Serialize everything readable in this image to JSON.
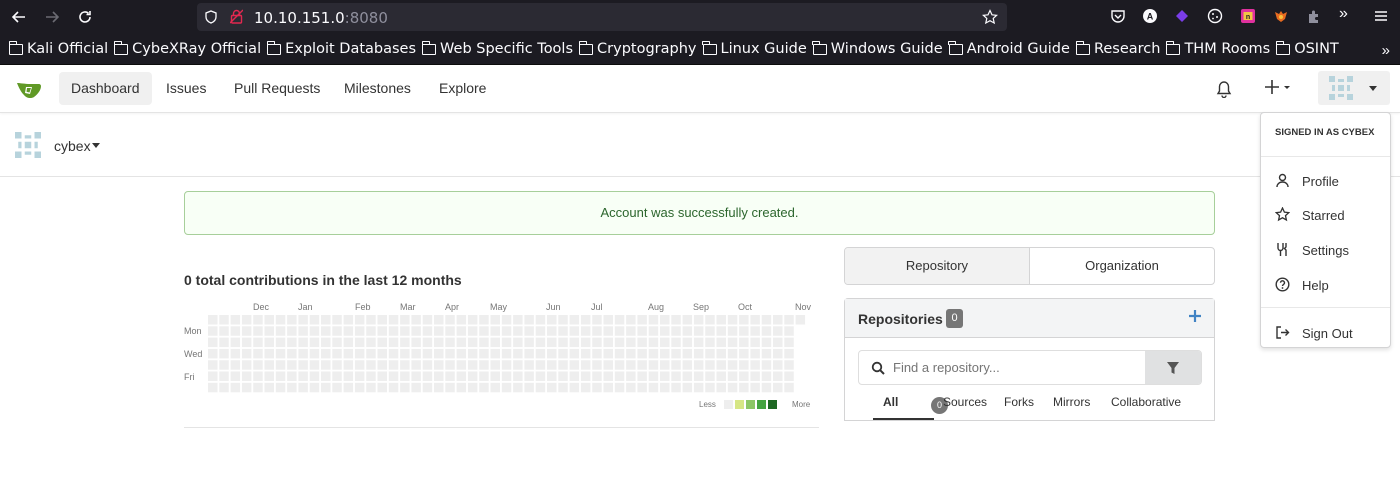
{
  "browser": {
    "url_host": "10.10.151.0",
    "url_port": ":8080",
    "bookmarks": [
      "Kali Official",
      "CybeXRay Official",
      "Exploit Databases",
      "Web Specific Tools",
      "Cryptography",
      "Linux Guide",
      "Windows Guide",
      "Android Guide",
      "Research",
      "THM Rooms",
      "OSINT"
    ]
  },
  "header": {
    "nav": [
      "Dashboard",
      "Issues",
      "Pull Requests",
      "Milestones",
      "Explore"
    ]
  },
  "context": {
    "username": "cybex"
  },
  "flash": {
    "message": "Account was successfully created."
  },
  "heatmap": {
    "title": "0 total contributions in the last 12 months",
    "months": [
      "Dec",
      "Jan",
      "Feb",
      "Mar",
      "Apr",
      "May",
      "Jun",
      "Jul",
      "Aug",
      "Sep",
      "Oct",
      "Nov"
    ],
    "days": [
      "Mon",
      "Wed",
      "Fri"
    ],
    "legend_less": "Less",
    "legend_more": "More",
    "empty_color": "#eeeeee",
    "legend_colors": [
      "#eeeeee",
      "#d6e685",
      "#8cc665",
      "#44a340",
      "#1e6823"
    ]
  },
  "panel": {
    "tabs": [
      "Repository",
      "Organization"
    ],
    "repos_title": "Repositories",
    "repos_count": "0",
    "search_placeholder": "Find a repository...",
    "filter_tabs": [
      "All",
      "Sources",
      "Forks",
      "Mirrors",
      "Collaborative"
    ],
    "all_count": "0"
  },
  "dropdown": {
    "signed_in_prefix": "SIGNED IN AS",
    "signed_in_user": "CYBEX",
    "items": [
      "Profile",
      "Starred",
      "Settings",
      "Help",
      "Sign Out"
    ]
  }
}
